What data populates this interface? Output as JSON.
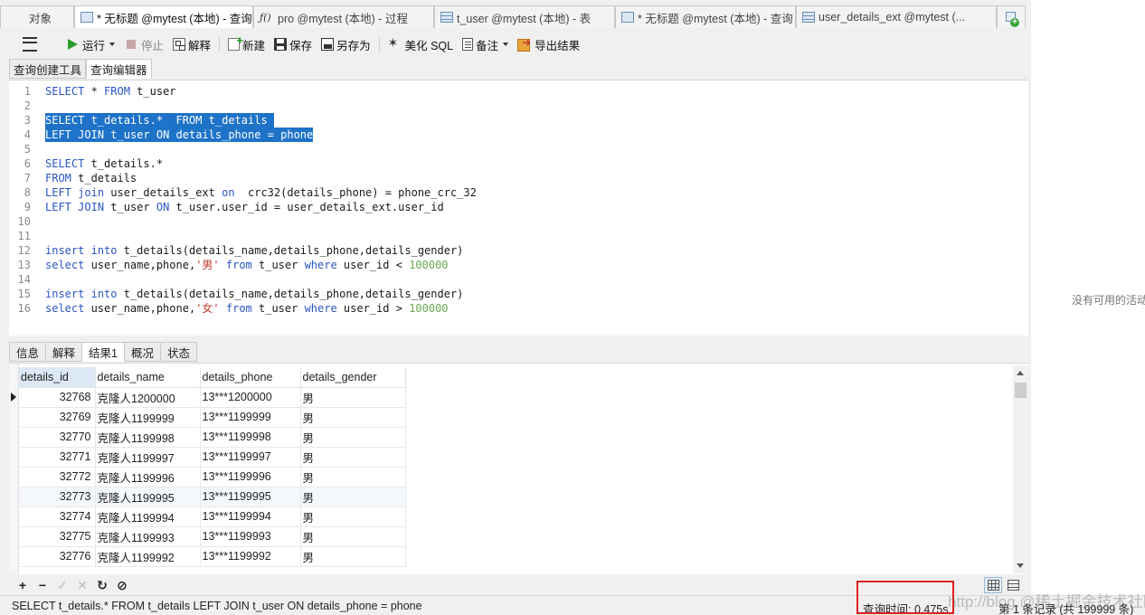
{
  "tabs": [
    {
      "label": "对象",
      "icon": "none",
      "active": false
    },
    {
      "label": "* 无标题 @mytest (本地) - 查询",
      "icon": "query-icon",
      "active": true
    },
    {
      "label": "pro @mytest (本地) - 过程",
      "icon": "function-icon",
      "active": false
    },
    {
      "label": "t_user @mytest (本地) - 表",
      "icon": "table-icon",
      "active": false
    },
    {
      "label": "* 无标题 @mytest (本地) - 查询",
      "icon": "query-icon",
      "active": false
    },
    {
      "label": "user_details_ext @mytest (...",
      "icon": "table-icon",
      "active": false
    }
  ],
  "toolbar": {
    "run_label": "运行",
    "stop_label": "停止",
    "explain_label": "解释",
    "new_label": "新建",
    "save_label": "保存",
    "saveas_label": "另存为",
    "beautify_label": "美化 SQL",
    "comment_label": "备注",
    "export_label": "导出结果"
  },
  "subtabs": {
    "builder": "查询创建工具",
    "editor": "查询编辑器"
  },
  "editor": {
    "lines": [
      {
        "n": "1",
        "text": "SELECT * FROM t_user"
      },
      {
        "n": "2",
        "text": ""
      },
      {
        "n": "3",
        "text": "SELECT t_details.*  FROM t_details ",
        "selected": true
      },
      {
        "n": "4",
        "text": "LEFT JOIN t_user ON details_phone = phone",
        "selected": true
      },
      {
        "n": "5",
        "text": ""
      },
      {
        "n": "6",
        "text": "SELECT t_details.*"
      },
      {
        "n": "7",
        "text": "FROM t_details"
      },
      {
        "n": "8",
        "text": "LEFT join user_details_ext on  crc32(details_phone) = phone_crc_32"
      },
      {
        "n": "9",
        "text": "LEFT JOIN t_user ON t_user.user_id = user_details_ext.user_id"
      },
      {
        "n": "10",
        "text": ""
      },
      {
        "n": "11",
        "text": ""
      },
      {
        "n": "12",
        "text": "insert into t_details(details_name,details_phone,details_gender)"
      },
      {
        "n": "13",
        "text": "select user_name,phone,'男' from t_user where user_id < 100000"
      },
      {
        "n": "14",
        "text": ""
      },
      {
        "n": "15",
        "text": "insert into t_details(details_name,details_phone,details_gender)"
      },
      {
        "n": "16",
        "text": "select user_name,phone,'女' from t_user where user_id > 100000"
      }
    ]
  },
  "result_tabs": [
    "信息",
    "解释",
    "结果1",
    "概况",
    "状态"
  ],
  "result_active": "结果1",
  "grid": {
    "columns": [
      "details_id",
      "details_name",
      "details_phone",
      "details_gender"
    ],
    "rows": [
      [
        "32768",
        "克隆人1200000",
        "13***1200000",
        "男"
      ],
      [
        "32769",
        "克隆人1199999",
        "13***1199999",
        "男"
      ],
      [
        "32770",
        "克隆人1199998",
        "13***1199998",
        "男"
      ],
      [
        "32771",
        "克隆人1199997",
        "13***1199997",
        "男"
      ],
      [
        "32772",
        "克隆人1199996",
        "13***1199996",
        "男"
      ],
      [
        "32773",
        "克隆人1199995",
        "13***1199995",
        "男"
      ],
      [
        "32774",
        "克隆人1199994",
        "13***1199994",
        "男"
      ],
      [
        "32775",
        "克隆人1199993",
        "13***1199993",
        "男"
      ],
      [
        "32776",
        "克隆人1199992",
        "13***1199992",
        "男"
      ]
    ]
  },
  "navbar": [
    "+",
    "−",
    "✓",
    "✕",
    "↻",
    "⊘"
  ],
  "status": {
    "sql": "SELECT t_details.*  FROM t_details LEFT JOIN t_user ON details_phone = phone",
    "time": "查询时间: 0.475s",
    "count": "第 1 条记录 (共 199999 条)"
  },
  "right_pane_message": "没有可用的活动",
  "watermark": "http://blog.@稀土掘金技术社区",
  "colors": {
    "selection": "#1e73c8",
    "keyword": "#2b55c2",
    "string": "#c0392b",
    "number": "#6aa84f",
    "highlight_box": "#e02020"
  }
}
